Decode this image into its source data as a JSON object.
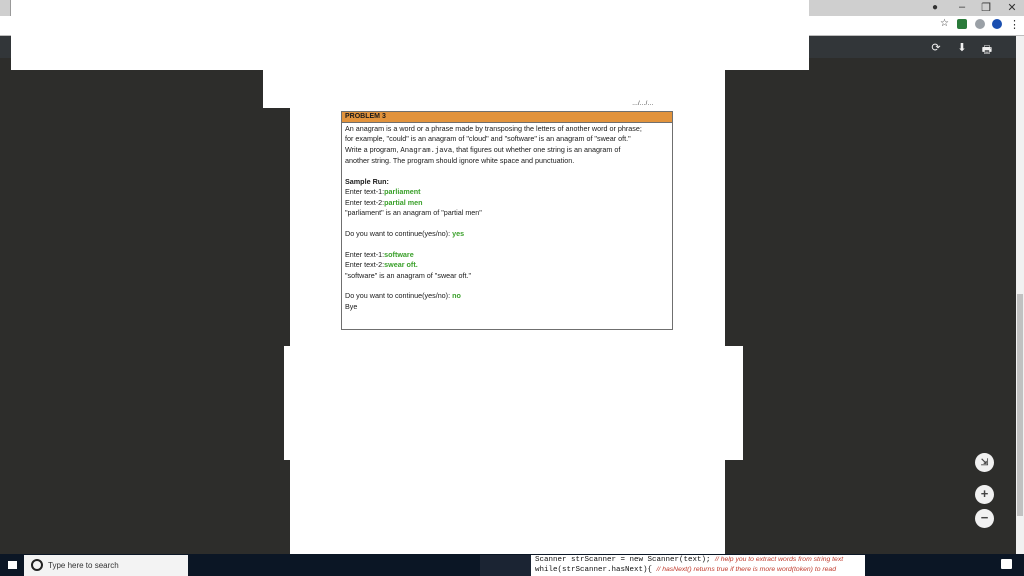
{
  "browser": {
    "window_controls": {
      "minimize": "–",
      "restore": "❐",
      "close": "✕"
    },
    "profile_icon": "account-circle-icon",
    "bookmark_star": "☆",
    "menu_dots": "⋮"
  },
  "pdf_toolbar": {
    "rotate_icon": "⟳",
    "download_icon": "⬇",
    "print_icon": "🖶"
  },
  "document": {
    "header_fragment": "…/…/…",
    "problem": {
      "title": "PROBLEM 3",
      "description": [
        "An anagram is a word or a phrase made by transposing the letters of another word or phrase;",
        "for example, \"could\" is an anagram of \"cloud\" and \"software\" is an anagram of \"swear oft.\"",
        "another string. The program should ignore white space and punctuation."
      ],
      "write_line": {
        "pre": "Write a program, ",
        "code": "Anagram.java",
        "post": ", that figures out whether one string is an anagram of"
      },
      "sample_run_label": "Sample Run:",
      "run": {
        "p1": {
          "label": "Enter text-1:",
          "value": "parliament"
        },
        "p2": {
          "label": "Enter text-2:",
          "value": "partial men"
        },
        "result1": "\"parliament\" is an anagram of \"partial men\"",
        "q1": {
          "label": "Do you want to continue(yes/no): ",
          "value": "yes"
        },
        "p3": {
          "label": "Enter text-1:",
          "value": "software"
        },
        "p4": {
          "label": "Enter text-2:",
          "value": "swear oft."
        },
        "result2": " \"software\" is an anagram of \"swear oft.\"",
        "q2": {
          "label": "Do you want to continue(yes/no): ",
          "value": "no"
        },
        "bye": "Bye"
      }
    }
  },
  "zoom": {
    "fit": "⇲",
    "zoom_in": "+",
    "zoom_out": "−"
  },
  "taskbar": {
    "search_placeholder": "Type here to search",
    "code_line1": "Scanner strScanner = new Scanner(text);",
    "code_comment1": "// help you to extract words from string text",
    "code_line2": "while(strScanner.hasNext){",
    "code_comment2": "// hasNext() returns true if there is more word(token) to read"
  }
}
